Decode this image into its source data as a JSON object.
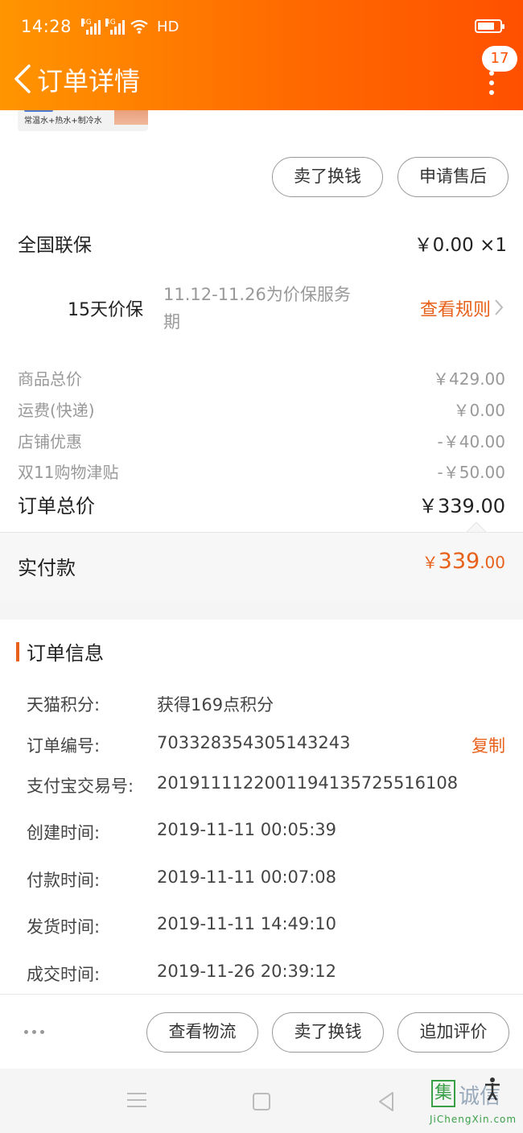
{
  "status_bar": {
    "time": "14:28",
    "signal1": "4G",
    "signal2": "4G",
    "hd": "HD"
  },
  "header": {
    "title": "订单详情",
    "message_count": "17"
  },
  "product": {
    "thumbnail_text": "常温水+热水+制冷水"
  },
  "product_actions": {
    "sell_label": "卖了换钱",
    "after_sale_label": "申请售后"
  },
  "warranty": {
    "title": "全国联保",
    "price": "￥0.00 ×1",
    "price_protect_label": "15天价保",
    "price_protect_desc": "11.12-11.26为价保服务期",
    "view_rules": "查看规则"
  },
  "price_breakdown": [
    {
      "label": "商品总价",
      "value": "￥429.00"
    },
    {
      "label": "运费(快递)",
      "value": "￥0.00"
    },
    {
      "label": "店铺优惠",
      "value": "-￥40.00"
    },
    {
      "label": "双11购物津贴",
      "value": "-￥50.00"
    }
  ],
  "order_total": {
    "label": "订单总价",
    "value": "￥339.00"
  },
  "paid": {
    "label": "实付款",
    "currency": "￥",
    "integer": "339",
    "decimal": ".00"
  },
  "order_info": {
    "title": "订单信息",
    "copy_label": "复制",
    "rows": [
      {
        "label": "天猫积分:",
        "value": "获得169点积分"
      },
      {
        "label": "订单编号:",
        "value": "703328354305143243"
      },
      {
        "label": "支付宝交易号:",
        "value": "2019111122001194135725516108"
      },
      {
        "label": "创建时间:",
        "value": "2019-11-11 00:05:39"
      },
      {
        "label": "付款时间:",
        "value": "2019-11-11 00:07:08"
      },
      {
        "label": "发货时间:",
        "value": "2019-11-11 14:49:10"
      },
      {
        "label": "成交时间:",
        "value": "2019-11-26 20:39:12"
      }
    ]
  },
  "bottom_actions": {
    "logistics": "查看物流",
    "sell": "卖了换钱",
    "review": "追加评价"
  },
  "watermark": {
    "char1": "集",
    "char2": "诚信",
    "url": "JiChengXin.com"
  },
  "colors": {
    "brand_orange": "#ff5000",
    "accent_text": "#e8611a"
  }
}
